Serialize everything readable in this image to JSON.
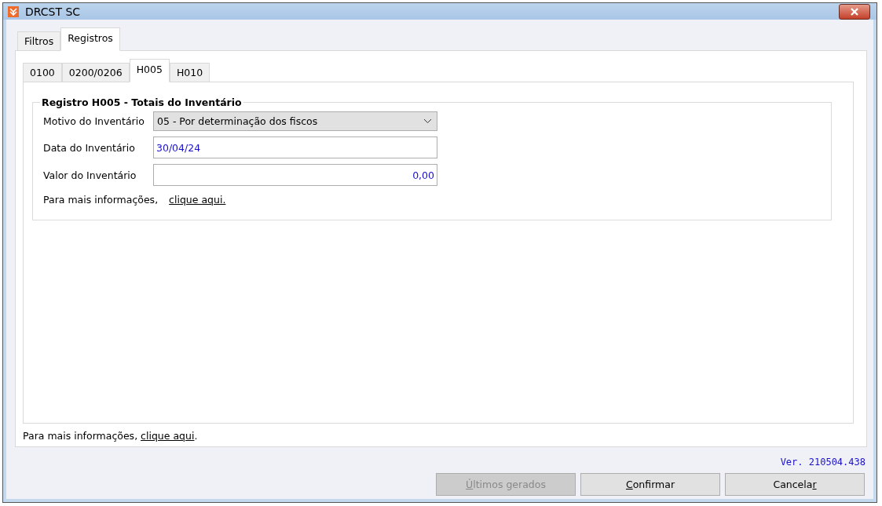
{
  "window": {
    "title": "DRCST SC"
  },
  "outer_tabs": [
    {
      "label": "Filtros",
      "selected": false
    },
    {
      "label": "Registros",
      "selected": true
    }
  ],
  "inner_tabs": [
    {
      "label": "0100",
      "selected": false
    },
    {
      "label": "0200/0206",
      "selected": false
    },
    {
      "label": "H005",
      "selected": true
    },
    {
      "label": "H010",
      "selected": false
    }
  ],
  "group": {
    "title": "Registro H005 - Totais do Inventário",
    "fields": [
      {
        "kind": "select",
        "label": "Motivo do Inventário",
        "value": "05 - Por determinação dos fiscos"
      },
      {
        "kind": "text",
        "label": "Data do Inventário",
        "value": "30/04/24"
      },
      {
        "kind": "number",
        "label": "Valor do Inventário",
        "value": "0,00"
      }
    ],
    "info": {
      "text": "Para mais informações,",
      "link": "clique aqui."
    }
  },
  "footer_info": {
    "text": "Para mais informações,",
    "link": "clique aqui",
    "after": "."
  },
  "version": "Ver. 210504.438",
  "buttons": [
    {
      "key": "Ú",
      "after": "ltimos gerados",
      "disabled": true
    },
    {
      "key": "C",
      "after": "onfirmar",
      "disabled": false
    },
    {
      "before": "Cancela",
      "key": "r",
      "disabled": false
    }
  ]
}
